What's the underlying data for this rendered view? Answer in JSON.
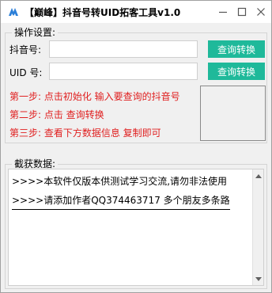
{
  "window": {
    "title": "【巅峰】抖音号转UID拓客工具v1.0",
    "icons": {
      "app": "aa-logo-icon",
      "minimize": "minimize-icon",
      "maximize": "maximize-icon",
      "close": "close-icon"
    }
  },
  "operations": {
    "legend": "操作设置:",
    "douyin_label": "抖音号:",
    "douyin_value": "",
    "uid_label": "UID 号:",
    "uid_value": "",
    "query_button_1": "查询转换",
    "query_button_2": "查询转换",
    "steps": [
      "第一步: 点击初始化 输入要查询的抖音号",
      "第二步: 点击 查询转换",
      "第三步: 查看下方数据信息 复制即可"
    ]
  },
  "log": {
    "legend": "截获数据:",
    "lines": [
      ">>>>本软件仅版本供测试学习交流,请勿非法使用",
      ">>>>请添加作者QQ374463717 多个朋友多条路"
    ]
  },
  "colors": {
    "accent": "#1fb99a",
    "step_text": "#e02020",
    "background": "#f0f0f0"
  }
}
